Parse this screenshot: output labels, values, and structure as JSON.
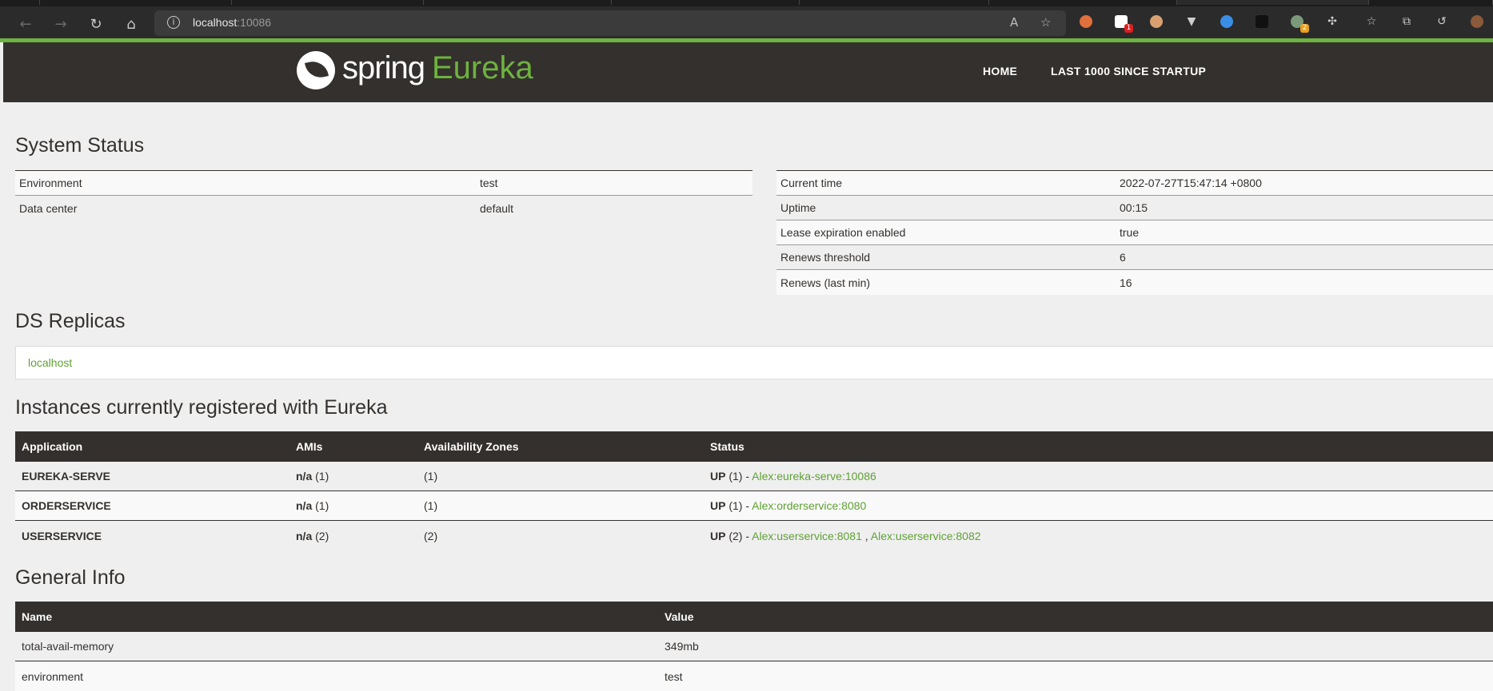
{
  "browser": {
    "url_host": "localhost",
    "url_port": ":10086"
  },
  "navbar": {
    "logo_spring": "spring",
    "logo_eureka": "Eureka",
    "home": "HOME",
    "last1000": "LAST 1000 SINCE STARTUP"
  },
  "system_status": {
    "title": "System Status",
    "left": [
      {
        "label": "Environment",
        "value": "test"
      },
      {
        "label": "Data center",
        "value": "default"
      }
    ],
    "right": [
      {
        "label": "Current time",
        "value": "2022-07-27T15:47:14 +0800"
      },
      {
        "label": "Uptime",
        "value": "00:15"
      },
      {
        "label": "Lease expiration enabled",
        "value": "true"
      },
      {
        "label": "Renews threshold",
        "value": "6"
      },
      {
        "label": "Renews (last min)",
        "value": "16"
      }
    ]
  },
  "replicas": {
    "title": "DS Replicas",
    "link": "localhost"
  },
  "instances": {
    "title": "Instances currently registered with Eureka",
    "headers": [
      "Application",
      "AMIs",
      "Availability Zones",
      "Status"
    ],
    "rows": [
      {
        "app": "EUREKA-SERVE",
        "ami_na": "n/a",
        "ami_count": "(1)",
        "zones": "(1)",
        "status_up": "UP",
        "status_count": "(1) -",
        "links": [
          "Alex:eureka-serve:10086"
        ]
      },
      {
        "app": "ORDERSERVICE",
        "ami_na": "n/a",
        "ami_count": "(1)",
        "zones": "(1)",
        "status_up": "UP",
        "status_count": "(1) -",
        "links": [
          "Alex:orderservice:8080"
        ]
      },
      {
        "app": "USERSERVICE",
        "ami_na": "n/a",
        "ami_count": "(2)",
        "zones": "(2)",
        "status_up": "UP",
        "status_count": "(2) -",
        "links": [
          "Alex:userservice:8081",
          "Alex:userservice:8082"
        ]
      }
    ]
  },
  "general_info": {
    "title": "General Info",
    "headers": [
      "Name",
      "Value"
    ],
    "rows": [
      {
        "name": "total-avail-memory",
        "value": "349mb"
      },
      {
        "name": "environment",
        "value": "test"
      }
    ]
  }
}
